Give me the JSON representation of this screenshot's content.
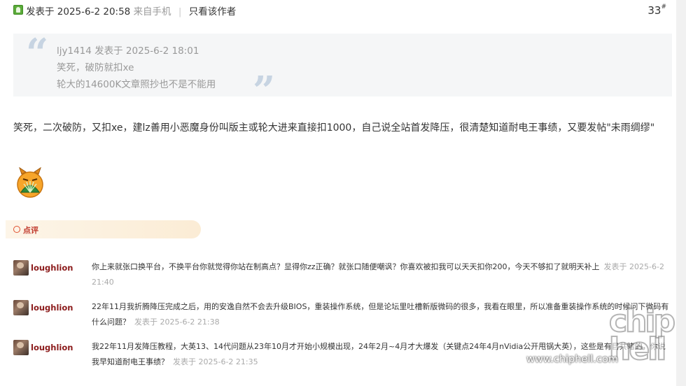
{
  "post": {
    "posted_label": "发表于 2025-6-2 20:58",
    "source": "来自手机",
    "only_author": "只看该作者",
    "floor": "33",
    "floor_sup": "#"
  },
  "quote": {
    "author_line": "ljy1414 发表于 2025-6-2 18:01",
    "line1": "笑死，破防就扣xe",
    "line2": "轮大的14600K文章照抄也不是不能用"
  },
  "body_text": "笑死，二次破防，又扣xe，建lz善用小恶魔身份叫版主或轮大进来直接扣1000，自己说全站首发降压，很清楚知道耐电王事绩，又要发帖\"未雨绸缪\"",
  "comment_section": {
    "label": "点评"
  },
  "comments": [
    {
      "user": "loughlion",
      "text": "你上来就张口换平台，不换平台你就觉得你站在制高点？显得你zz正确？就张口随便嘲讽？你喜欢被扣我可以天天扣你200，今天不够扣了就明天补上",
      "time": "发表于 2025-6-2 21:40"
    },
    {
      "user": "loughlion",
      "text": "22年11月我折腾降压完成之后，用的安逸自然不会去升级BIOS，重装操作系统，但是论坛里吐槽新版微码的很多，我看在眼里，所以准备重装操作系统的时候问下微码有什么问题？",
      "time": "发表于 2025-6-2 21:38"
    },
    {
      "user": "loughlion",
      "text": "我22年11月发降压教程，大英13、14代问题从23年10月才开始小规模出现，24年2月~4月才大爆发（关键点24年4月nVidia公开甩锅大英），这些是有目共睹的，你说我早知道耐电王事绩？",
      "time": "发表于 2025-6-2 21:35"
    }
  ],
  "watermark": {
    "logo": "chip hell",
    "url": "www.chiphell.com"
  },
  "colors": {
    "username": "#8b1a1a",
    "comment_label": "#c0392b",
    "quote_bg": "#f5f6f7"
  }
}
